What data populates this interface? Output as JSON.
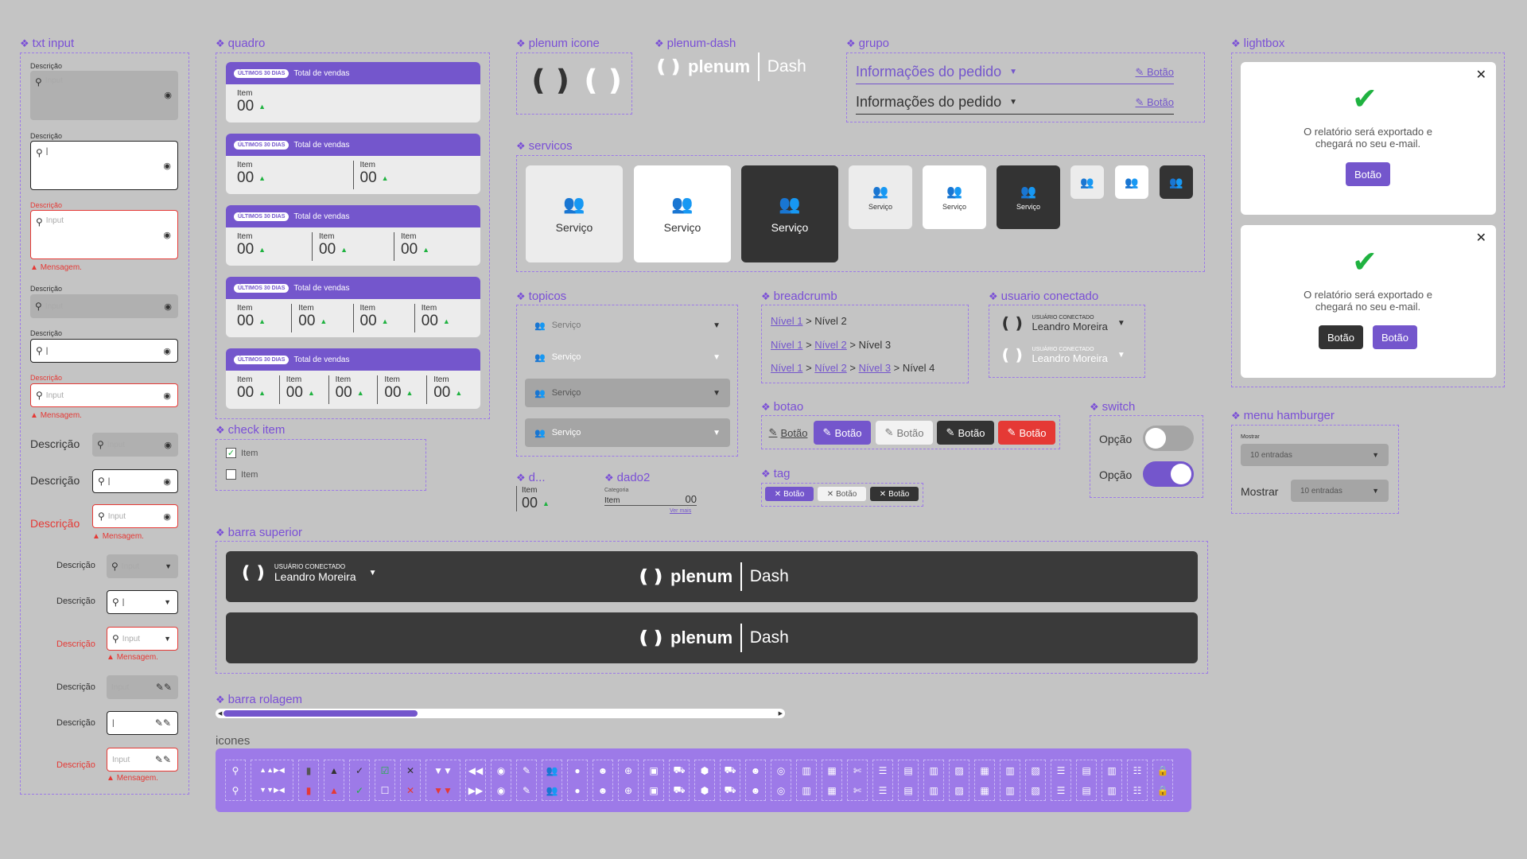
{
  "sections": {
    "txt_input": "txt input",
    "quadro": "quadro",
    "plenum_icone": "plenum icone",
    "plenum_dash": "plenum-dash",
    "grupo": "grupo",
    "lightbox": "lightbox",
    "servicos": "servicos",
    "topicos": "topicos",
    "breadcrumb": "breadcrumb",
    "usuario": "usuario conectado",
    "botao": "botao",
    "switch": "switch",
    "menu": "menu hamburger",
    "check": "check item",
    "d": "d...",
    "dado2": "dado2",
    "tag": "tag",
    "barra_superior": "barra superior",
    "barra_rolagem": "barra rolagem",
    "icones": "icones"
  },
  "txt": {
    "descricao": "Descrição",
    "input": "Input",
    "mensagem": "Mensagem.",
    "cursor": "|"
  },
  "quadro": {
    "pill": "ÚLTIMOS 30 DIAS",
    "title": "Total de vendas",
    "item": "Item",
    "value": "00"
  },
  "brand": {
    "logo": "plenum",
    "dash": "Dash"
  },
  "grupo": {
    "title": "Informações do pedido",
    "botao": "Botão"
  },
  "lightbox": {
    "message": "O relatório será exportado e chegará no seu e-mail.",
    "botao": "Botão"
  },
  "servico": "Serviço",
  "breadcrumb": {
    "nivel1": "Nível 1",
    "nivel2": "Nível 2",
    "nivel3": "Nível 3",
    "nivel4": "Nível 4"
  },
  "usuario": {
    "label": "USUÁRIO CONECTADO",
    "name": "Leandro Moreira"
  },
  "botao": "Botão",
  "switch": {
    "opcao": "Opção"
  },
  "menu": {
    "mostrar": "Mostrar",
    "entradas": "10 entradas"
  },
  "check": {
    "item": "Item"
  },
  "dado2": {
    "categoria": "Categoria",
    "item": "Item",
    "value": "00",
    "ver_mais": "Ver mais"
  },
  "scroll_progress": 0.35,
  "colors": {
    "accent": "#7456cc",
    "dark": "#333333",
    "error": "#e53935",
    "success": "#1fb240"
  }
}
